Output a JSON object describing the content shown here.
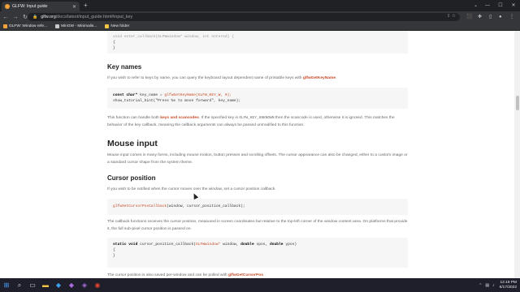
{
  "browser": {
    "tab_title": "GLFW: Input guide",
    "url_host": "glfw.org",
    "url_path": "/docs/latest/input_guide.html#input_key",
    "bookmarks": [
      {
        "label": "GLFW: Window refe...",
        "color": "#f2a33a"
      },
      {
        "label": "MinGW - Minimalis...",
        "color": "#c9c9c9"
      },
      {
        "label": "New folder",
        "color": "#f4c542"
      }
    ]
  },
  "doc": {
    "top_code_line": "void enter_callback(GLFWwindow* window, int entered) {",
    "top_code_brace1": "{",
    "top_code_brace2": "}",
    "key_names_title": "Key names",
    "key_names_intro_a": "If you wish to refer to keys by name, you can query the keyboard layout dependent name of printable keys with ",
    "key_names_intro_link": "glfwGetKeyName",
    "key_names_intro_b": ".",
    "code2_l1_a": "const char* ",
    "code2_l1_b": "key_name = ",
    "code2_l1_fn": "glfwGetKeyName(GLFW_KEY_W, 0);",
    "code2_l2": "show_tutorial_hint(\"Press %s to move forward\", key_name);",
    "key_names_p2_a": "This function can handle both ",
    "key_names_p2_link": "keys and scancodes",
    "key_names_p2_b": ". If the specified key is ",
    "key_names_p2_mono": "GLFW_KEY_UNKNOWN",
    "key_names_p2_c": " then the scancode is used, otherwise it is ignored. This matches the behavior of the key callback, meaning the callback arguments can always be passed unmodified to this function.",
    "mouse_title": "Mouse input",
    "mouse_p": "Mouse input comes in many forms, including mouse motion, button presses and scrolling offsets. The cursor appearance can also be changed, either to a custom image or a standard cursor shape from the system theme.",
    "cursor_title": "Cursor position",
    "cursor_p": "If you wish to be notified when the cursor moves over the window, set a cursor position callback.",
    "code3_fn": "glfwSetCursorPosCallback",
    "code3_rest": "(window, cursor_position_callback);",
    "callback_p": "The callback functions receives the cursor position, measured in screen coordinates but relative to the top-left corner of the window content area. On platforms that provide it, the full sub-pixel cursor position is passed on.",
    "code4_kw1": "static void ",
    "code4_name": "cursor_position_callback(",
    "code4_type": "GLFWwindow*",
    "code4_mid": " window, ",
    "code4_kw2": "double",
    "code4_x": " xpos, ",
    "code4_kw3": "double",
    "code4_y": " ypos)",
    "code4_brace1": "{",
    "code4_brace2": "}",
    "bottom_p_a": "The cursor position is also saved per-window and can be polled with ",
    "bottom_p_link": "glfwGetCursorPos",
    "bottom_p_b": "."
  },
  "taskbar": {
    "time": "12:19 PM",
    "date": "6/17/2022"
  }
}
